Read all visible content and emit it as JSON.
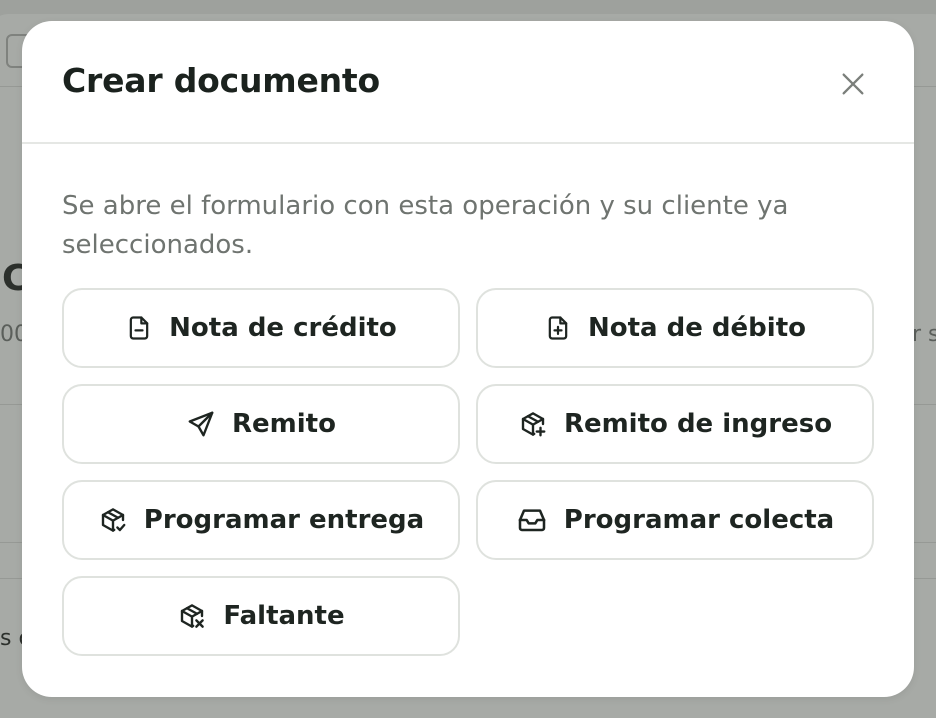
{
  "background": {
    "fragment_heading": "C",
    "fragment_number": "00",
    "fragment_right": "r s",
    "fragment_bottom": "s c"
  },
  "modal": {
    "title": "Crear documento",
    "description": "Se abre el formulario con esta operación y su cliente ya seleccionados.",
    "options": [
      {
        "label": "Nota de crédito",
        "icon": "file-minus-icon"
      },
      {
        "label": "Nota de débito",
        "icon": "file-plus-icon"
      },
      {
        "label": "Remito",
        "icon": "send-icon"
      },
      {
        "label": "Remito de ingreso",
        "icon": "package-plus-icon"
      },
      {
        "label": "Programar entrega",
        "icon": "package-check-icon"
      },
      {
        "label": "Programar colecta",
        "icon": "inbox-icon"
      },
      {
        "label": "Faltante",
        "icon": "package-x-icon"
      }
    ]
  },
  "colors": {
    "backdrop": "#9ea19d",
    "modal_bg": "#ffffff",
    "title": "#1b221e",
    "description": "#6f7470",
    "button_border": "#dfe2de"
  }
}
